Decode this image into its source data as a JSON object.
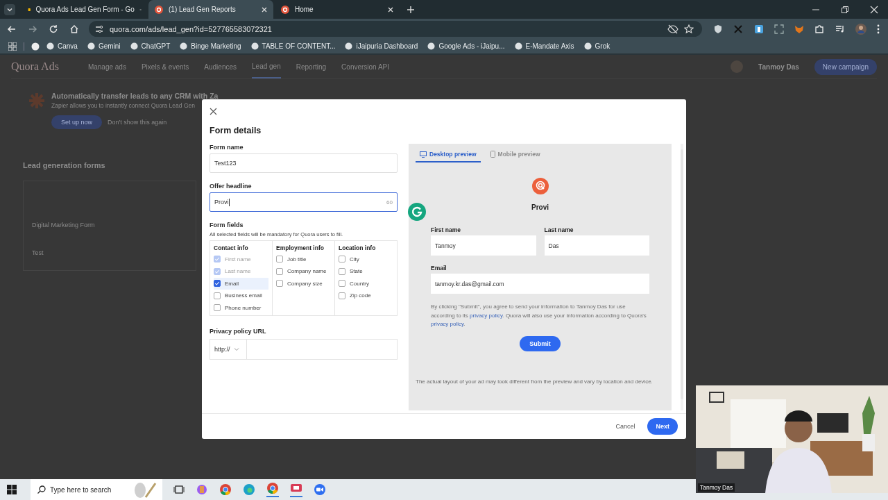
{
  "browser": {
    "tabs": [
      {
        "title": "Quora Ads Lead Gen Form - Go",
        "selected": false
      },
      {
        "title": "(1) Lead Gen Reports",
        "selected": true
      },
      {
        "title": "Home",
        "selected": false
      }
    ],
    "url": "quora.com/ads/lead_gen?id=527765583072321",
    "bookmarks": [
      "Canva",
      "Gemini",
      "ChatGPT",
      "Binge Marketing",
      "TABLE OF CONTENT...",
      "iJaipuria Dashboard",
      "Google Ads - iJaipu...",
      "E-Mandate Axis",
      "Grok"
    ]
  },
  "page": {
    "logo": "Quora Ads",
    "nav": [
      {
        "label": "Manage ads",
        "selected": false
      },
      {
        "label": "Pixels & events",
        "selected": false
      },
      {
        "label": "Audiences",
        "selected": false
      },
      {
        "label": "Lead gen",
        "selected": true
      },
      {
        "label": "Reporting",
        "selected": false
      },
      {
        "label": "Conversion API",
        "selected": false
      }
    ],
    "user": "Tanmoy Das",
    "new_campaign": "New campaign",
    "banner": {
      "title": "Automatically transfer leads to any CRM with Za",
      "text": "Zapier allows you to instantly connect Quora Lead Gen",
      "button": "Set up now",
      "dismiss": "Don't show this again"
    },
    "section_title": "Lead generation forms",
    "forms": [
      "Digital Marketing Form",
      "Test"
    ]
  },
  "modal": {
    "title": "Form details",
    "form_name": {
      "label": "Form name",
      "value": "Test123"
    },
    "headline": {
      "label": "Offer headline",
      "value": "Provi",
      "counter": "60"
    },
    "form_fields": {
      "label": "Form fields",
      "hint": "All selected fields will be mandatory for Quora users to fill.",
      "groups": [
        {
          "title": "Contact info",
          "fields": [
            {
              "label": "First name",
              "checked": true,
              "disabled": true,
              "hovered": false
            },
            {
              "label": "Last name",
              "checked": true,
              "disabled": true,
              "hovered": false
            },
            {
              "label": "Email",
              "checked": true,
              "disabled": false,
              "hovered": true
            },
            {
              "label": "Business email",
              "checked": false,
              "disabled": false,
              "hovered": false
            },
            {
              "label": "Phone number",
              "checked": false,
              "disabled": false,
              "hovered": false
            }
          ]
        },
        {
          "title": "Employment info",
          "fields": [
            {
              "label": "Job title",
              "checked": false,
              "disabled": false,
              "hovered": false
            },
            {
              "label": "Company name",
              "checked": false,
              "disabled": false,
              "hovered": false
            },
            {
              "label": "Company size",
              "checked": false,
              "disabled": false,
              "hovered": false
            }
          ]
        },
        {
          "title": "Location info",
          "fields": [
            {
              "label": "City",
              "checked": false,
              "disabled": false,
              "hovered": false
            },
            {
              "label": "State",
              "checked": false,
              "disabled": false,
              "hovered": false
            },
            {
              "label": "Country",
              "checked": false,
              "disabled": false,
              "hovered": false
            },
            {
              "label": "Zip code",
              "checked": false,
              "disabled": false,
              "hovered": false
            }
          ]
        }
      ]
    },
    "privacy": {
      "label": "Privacy policy URL",
      "protocol": "http://"
    },
    "preview": {
      "tabs": [
        {
          "label": "Desktop preview",
          "kind": "desktop",
          "selected": true
        },
        {
          "label": "Mobile preview",
          "kind": "mobile",
          "selected": false
        }
      ],
      "headline": "Provi",
      "rows": [
        [
          {
            "label": "First name",
            "value": "Tanmoy"
          },
          {
            "label": "Last name",
            "value": "Das"
          }
        ],
        [
          {
            "label": "Email",
            "value": "tanmoy.kr.das@gmail.com"
          }
        ]
      ],
      "consent": [
        {
          "text": "By clicking \"Submit\", you agree to send your information to Tanmoy Das for use according to its ",
          "link": false
        },
        {
          "text": "privacy policy",
          "link": true
        },
        {
          "text": ". Quora will also use your information according to Quora's ",
          "link": false
        },
        {
          "text": "privacy policy",
          "link": true
        },
        {
          "text": ".",
          "link": false
        }
      ],
      "submit": "Submit",
      "note": "The actual layout of your ad may look different from the preview and vary by location and device."
    },
    "cancel": "Cancel",
    "next": "Next"
  },
  "webcam": {
    "kind": "picture",
    "name": "Tanmoy Das"
  },
  "taskbar": {
    "search_placeholder": "Type here to search"
  }
}
